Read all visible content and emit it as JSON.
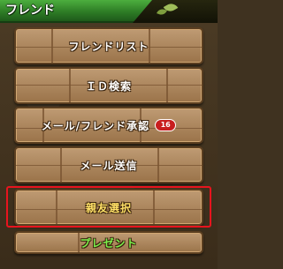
{
  "header": {
    "title": "フレンド"
  },
  "menu": {
    "friend_list": "フレンドリスト",
    "id_search": "ＩＤ検索",
    "mail_friend_approval": "メール/フレンド承認",
    "mail_badge_count": "16",
    "send_mail": "メール送信",
    "best_friend_select": "親友選択",
    "present": "プレゼント"
  },
  "colors": {
    "header_green": "#2e7d26",
    "button_stone": "#b08454",
    "highlight_red": "#e8141e",
    "badge_red": "#c81e1e",
    "gold_text": "#ffe066",
    "green_text": "#7cf04c"
  }
}
